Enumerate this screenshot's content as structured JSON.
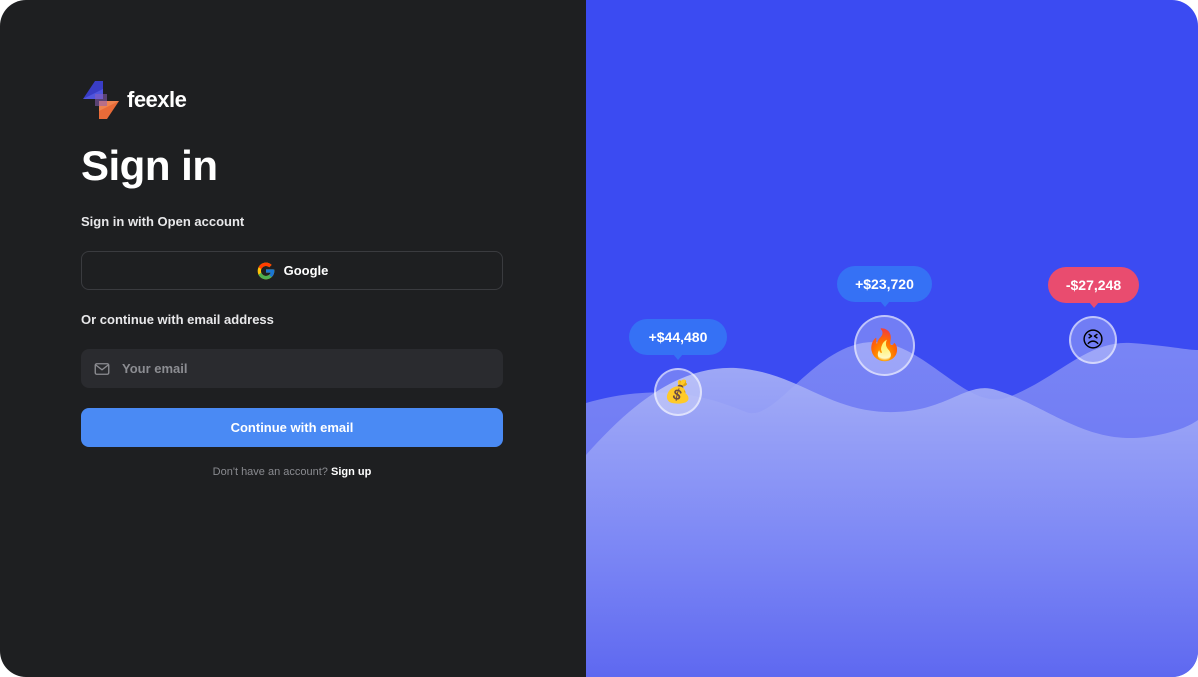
{
  "brand": {
    "name": "feexle"
  },
  "signin": {
    "title": "Sign in",
    "subtitle": "Sign in with Open account",
    "google_label": "Google",
    "or_text": "Or continue with email address",
    "email_placeholder": "Your email",
    "email_value": "",
    "continue_label": "Continue with email",
    "no_account_text": "Don't have an account?",
    "signup_link": "Sign up"
  },
  "highlights": [
    {
      "value": "+$44,480",
      "emoji": "💰",
      "type": "gain"
    },
    {
      "value": "+$23,720",
      "emoji": "🔥",
      "type": "gain"
    },
    {
      "value": "-$27,248",
      "emoji": "😣",
      "type": "loss"
    }
  ],
  "colors": {
    "panel_dark": "#1e1f21",
    "panel_blue": "#3b4bf2",
    "accent": "#4a8af4",
    "gain_bubble": "#3571f5",
    "loss_bubble": "#e94c6f"
  },
  "icons": [
    "logo-mark-icon",
    "google-icon",
    "mail-icon"
  ]
}
